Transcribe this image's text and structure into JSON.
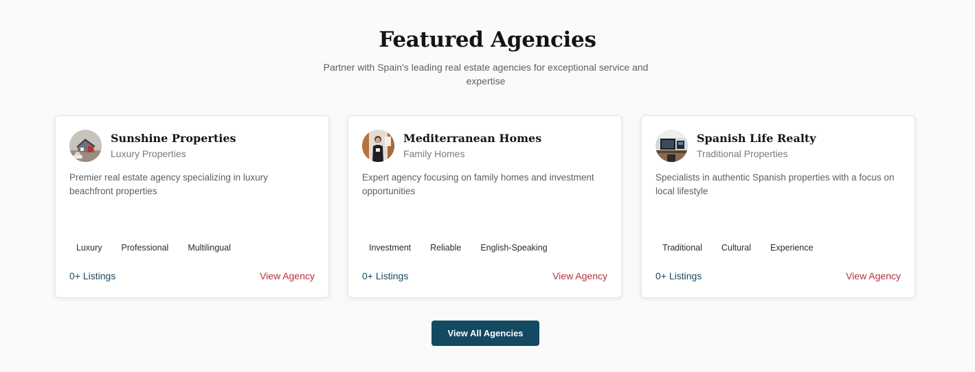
{
  "section": {
    "title": "Featured Agencies",
    "subtitle": "Partner with Spain's leading real estate agencies for exceptional service and expertise"
  },
  "agencies": [
    {
      "name": "Sunshine Properties",
      "type": "Luxury Properties",
      "description": "Premier real estate agency specializing in luxury beachfront properties",
      "tags": [
        "Luxury",
        "Professional",
        "Multilingual"
      ],
      "listings": "0+ Listings",
      "link_label": "View Agency",
      "avatar_icon": "house-model-photo-icon"
    },
    {
      "name": "Mediterranean Homes",
      "type": "Family Homes",
      "description": "Expert agency focusing on family homes and investment opportunities",
      "tags": [
        "Investment",
        "Reliable",
        "English-Speaking"
      ],
      "listings": "0+ Listings",
      "link_label": "View Agency",
      "avatar_icon": "agent-portrait-photo-icon"
    },
    {
      "name": "Spanish Life Realty",
      "type": "Traditional Properties",
      "description": "Specialists in authentic Spanish properties with a focus on local lifestyle",
      "tags": [
        "Traditional",
        "Cultural",
        "Experience"
      ],
      "listings": "0+ Listings",
      "link_label": "View Agency",
      "avatar_icon": "office-desk-photo-icon"
    }
  ],
  "cta": {
    "label": "View All Agencies"
  },
  "colors": {
    "primary": "#134a62",
    "accent": "#b0313c",
    "listings": "#17495e",
    "background": "#fafafa"
  }
}
